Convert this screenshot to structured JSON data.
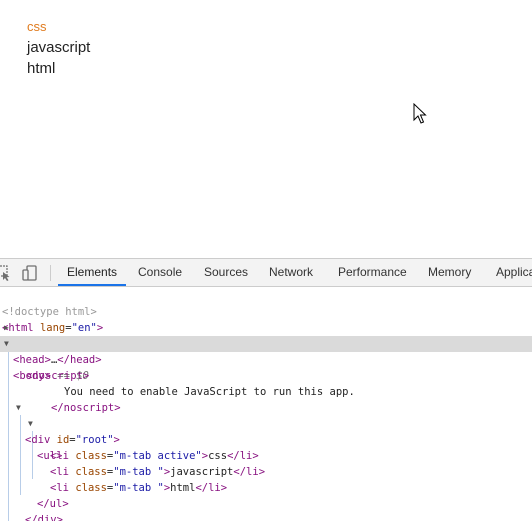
{
  "page": {
    "tabs": [
      {
        "label": "css",
        "active": true
      },
      {
        "label": "javascript",
        "active": false
      },
      {
        "label": "html",
        "active": false
      }
    ],
    "cursor_icon": "mouse-pointer-icon"
  },
  "devtools": {
    "toolbar_icons": [
      "inspect-element-icon",
      "device-toolbar-icon"
    ],
    "tabs": [
      "Elements",
      "Console",
      "Sources",
      "Network",
      "Performance",
      "Memory",
      "Applica"
    ],
    "active_tab": "Elements",
    "dom": {
      "doctype": "<!doctype html>",
      "html_tag": "html",
      "html_lang_attr": "lang",
      "html_lang_val": "\"en\"",
      "head_tag": "head",
      "head_ellipsis": "…",
      "body_tag": "body",
      "body_marker": " == $0",
      "noscript_tag": "noscript",
      "noscript_text": "You need to enable JavaScript to run this app.",
      "div_tag": "div",
      "div_id_attr": "id",
      "div_id_val": "\"root\"",
      "ul_tag": "ul",
      "li_tag": "li",
      "li_class_attr": "class",
      "li_items": [
        {
          "class_val": "\"m-tab active\"",
          "text": "css"
        },
        {
          "class_val": "\"m-tab \"",
          "text": "javascript"
        },
        {
          "class_val": "\"m-tab \"",
          "text": "html"
        }
      ],
      "comment_partial": "<!--"
    },
    "colors": {
      "tag": "#881280",
      "attr_name": "#994500",
      "attr_value": "#1a1aa6",
      "active_tab_underline": "#1a73e8",
      "selected_row": "#dadada",
      "active_page_tab": "#e07c20"
    }
  }
}
